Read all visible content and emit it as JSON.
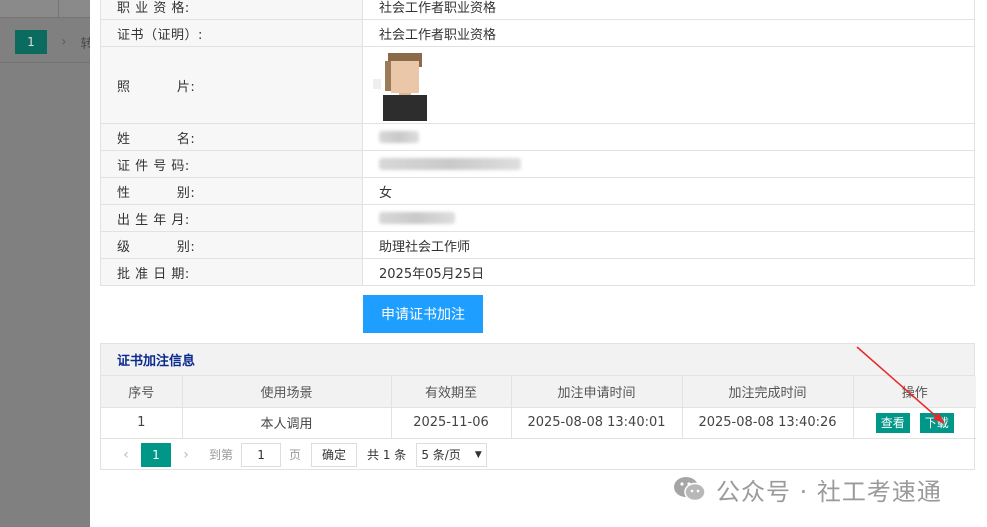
{
  "background": {
    "pager_current": "1",
    "pager_chevron": "›",
    "truncated_text": "转"
  },
  "info_rows": [
    {
      "label": "职 业 资 格:",
      "value": "社会工作者职业资格"
    },
    {
      "label": "证书（证明）:",
      "value": "社会工作者职业资格"
    },
    {
      "label": "照          片:",
      "value": ""
    },
    {
      "label": "姓          名:",
      "value": ""
    },
    {
      "label": "证 件 号 码:",
      "value": ""
    },
    {
      "label": "性          别:",
      "value": "女"
    },
    {
      "label": "出 生 年 月:",
      "value": ""
    },
    {
      "label": "级          别:",
      "value": "助理社会工作师"
    },
    {
      "label": "批 准 日 期:",
      "value": "2025年05月25日"
    }
  ],
  "apply_button": "申请证书加注",
  "note_panel": {
    "title": "证书加注信息",
    "headers": [
      "序号",
      "使用场景",
      "有效期至",
      "加注申请时间",
      "加注完成时间",
      "操作"
    ],
    "rows": [
      {
        "index": "1",
        "scene": "本人调用",
        "valid_until": "2025-11-06",
        "apply_time": "2025-08-08 13:40:01",
        "complete_time": "2025-08-08 13:40:26",
        "view": "查看",
        "download": "下载"
      }
    ]
  },
  "pager": {
    "prev": "‹",
    "current": "1",
    "next": "›",
    "goto_label": "到第",
    "page_input": "1",
    "page_unit": "页",
    "confirm": "确定",
    "total": "共 1 条",
    "page_size": "5 条/页",
    "dropdown_arrow": "▼"
  },
  "watermark": {
    "text": "公众号 · 社工考速通"
  },
  "colors": {
    "primary": "#1e9fff",
    "teal": "#009688",
    "title_blue": "#0a2a8f",
    "arrow_red": "#e8282b"
  }
}
